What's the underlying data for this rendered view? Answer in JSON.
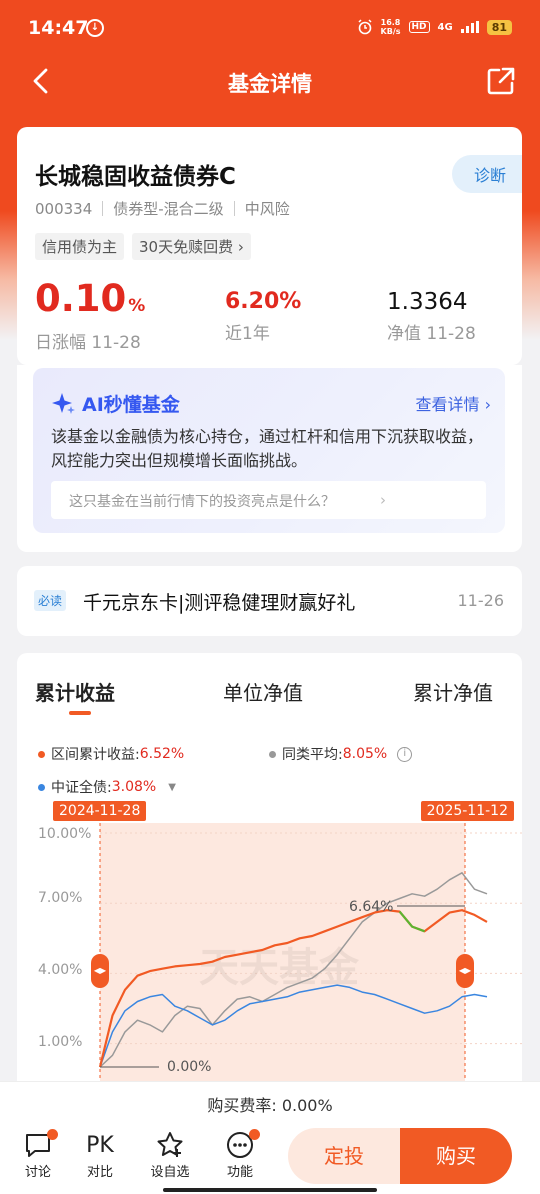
{
  "status": {
    "time": "14:47",
    "speed_top": "16.8",
    "speed_bottom": "KB/s",
    "hd": "HD",
    "net": "4G",
    "battery": "81"
  },
  "nav": {
    "title": "基金详情"
  },
  "fund": {
    "name": "长城稳固收益债券C",
    "diagnose": "诊断",
    "code": "000334",
    "type": "债券型-混合二级",
    "risk": "中风险",
    "tags": [
      "信用债为主",
      "30天免赎回费 ›"
    ],
    "daily_change": "0.10",
    "daily_change_unit": "%",
    "daily_change_label": "日涨幅 11-28",
    "year_return": "6.20%",
    "year_return_label": "近1年",
    "nav_value": "1.3364",
    "nav_label": "净值 11-28"
  },
  "ai": {
    "title": "AI秒懂基金",
    "more": "查看详情 ›",
    "text": "该基金以金融债为核心持仓，通过杠杆和信用下沉获取收益，风控能力突出但规模增长面临挑战。",
    "question": "这只基金在当前行情下的投资亮点是什么？",
    "question_chev": "›"
  },
  "news": {
    "badge": "必读",
    "text": "千元京东卡|测评稳健理财赢好礼",
    "date": "11-26"
  },
  "chart_tabs": [
    "累计收益",
    "单位净值",
    "累计净值"
  ],
  "legend": {
    "fund_label": "区间累计收益:",
    "fund_value": "6.52%",
    "peer_label": "同类平均:",
    "peer_value": "8.05%",
    "index_label": "中证全债:",
    "index_value": "3.08%"
  },
  "chart_data": {
    "type": "line",
    "start_date": "2024-11-28",
    "end_date": "2025-11-12",
    "y_ticks": [
      "10.00%",
      "7.00%",
      "4.00%",
      "1.00%"
    ],
    "ylim": [
      0,
      10
    ],
    "annotations": [
      "6.64%",
      "0.00%"
    ],
    "watermark": "天天基金",
    "colors": {
      "fund": "#f15a24",
      "peer": "#999999",
      "index": "#3a86e0",
      "highlight": "#5cb531"
    },
    "series": [
      {
        "name": "区间累计收益",
        "values": [
          0,
          2.2,
          3.3,
          3.9,
          4.1,
          4.2,
          4.3,
          4.35,
          4.4,
          4.5,
          4.7,
          4.8,
          4.9,
          5.0,
          5.2,
          5.3,
          5.5,
          5.6,
          5.8,
          6.0,
          6.2,
          6.4,
          6.6,
          6.7,
          6.64,
          6.0,
          5.8,
          6.2,
          6.6,
          6.7,
          6.5,
          6.2
        ]
      },
      {
        "name": "同类平均",
        "values": [
          0,
          0.5,
          1.5,
          2.0,
          1.8,
          1.5,
          2.2,
          2.6,
          2.5,
          1.8,
          2.4,
          2.9,
          3.0,
          2.8,
          3.1,
          3.4,
          3.6,
          3.8,
          4.2,
          4.8,
          5.5,
          6.2,
          6.6,
          7.0,
          7.2,
          7.4,
          7.3,
          7.6,
          8.0,
          8.3,
          7.6,
          7.4
        ]
      },
      {
        "name": "中证全债",
        "values": [
          0,
          1.5,
          2.4,
          2.8,
          3.0,
          3.1,
          2.6,
          2.4,
          2.1,
          1.8,
          2.0,
          2.4,
          2.7,
          2.8,
          2.9,
          3.0,
          3.2,
          3.3,
          3.4,
          3.5,
          3.4,
          3.2,
          3.1,
          2.9,
          2.7,
          2.5,
          2.3,
          2.4,
          2.6,
          3.0,
          3.1,
          3.0
        ]
      }
    ]
  },
  "fee": {
    "label": "购买费率:",
    "value": "0.00%"
  },
  "bottom": {
    "items": [
      {
        "icon": "chat-icon",
        "label": "讨论"
      },
      {
        "icon": "pk-icon",
        "label": "对比",
        "glyph": "PK"
      },
      {
        "icon": "star-plus-icon",
        "label": "设自选"
      },
      {
        "icon": "more-dots-icon",
        "label": "功能"
      }
    ],
    "dingtou": "定投",
    "buy": "购买"
  }
}
